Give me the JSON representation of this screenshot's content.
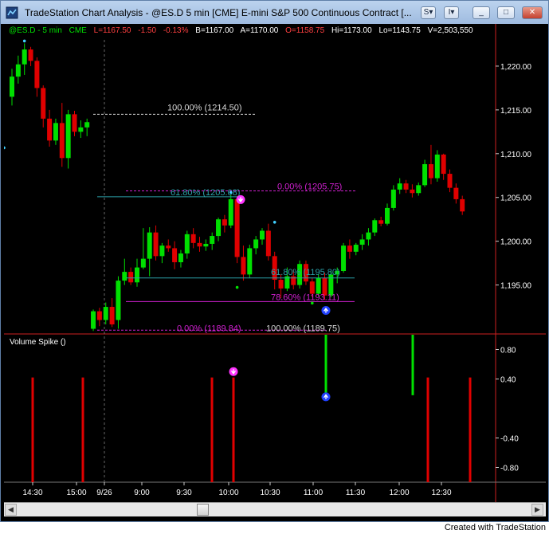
{
  "window": {
    "title": "TradeStation Chart Analysis - @ES.D  5 min  [CME] E-mini S&P 500 Continuous Contract [...",
    "buttons": [
      "S",
      "I",
      "_",
      "□",
      "✕"
    ]
  },
  "status": {
    "symbol": "@ES.D - 5 min",
    "exchange": "CME",
    "last": "L=1167.50",
    "change": "-1.50",
    "change_pct": "-0.13%",
    "bid": "B=1167.00",
    "ask": "A=1170.00",
    "open": "O=1158.75",
    "high": "Hi=1173.00",
    "low": "Lo=1143.75",
    "volume": "V=2,503,550"
  },
  "colors": {
    "up": "#00e000",
    "down": "#e00000",
    "fib_white": "#d8d8d8",
    "fib_cyan": "#2aa0a8",
    "fib_magenta": "#d020d0",
    "marker_magenta": "#ff33ff",
    "marker_blue": "#2040ff"
  },
  "price_axis": {
    "labels": [
      "1,220.00",
      "1,215.00",
      "1,210.00",
      "1,205.00",
      "1,200.00",
      "1,195.00"
    ],
    "values": [
      1220,
      1215,
      1210,
      1205,
      1200,
      1195
    ],
    "range": [
      1189.5,
      1223.0
    ]
  },
  "fib_labels": [
    "100.00% (1214.50)",
    "61.80% (1205.08)",
    "0.00% (1205.75)",
    "61.80% (1195.80)",
    "78.60% (1193.11)",
    "0.00% (1189.84)",
    "100.00% (1189.75)"
  ],
  "volume_panel": {
    "title": "Volume Spike ()",
    "axis_labels": [
      "0.80",
      "0.40",
      "-0.40",
      "-0.80"
    ],
    "axis_values": [
      0.8,
      0.4,
      -0.4,
      -0.8
    ],
    "range": [
      -1.0,
      1.0
    ]
  },
  "time_axis": {
    "labels": [
      "14:30",
      "15:00",
      "9/26",
      "9:00",
      "9:30",
      "10:00",
      "10:30",
      "11:00",
      "11:30",
      "12:00",
      "12:30"
    ]
  },
  "footer": "Created with TradeStation",
  "icons": {
    "app": "tradestation-app-icon",
    "scroll_left": "arrow-left-icon",
    "scroll_right": "arrow-right-icon"
  }
}
